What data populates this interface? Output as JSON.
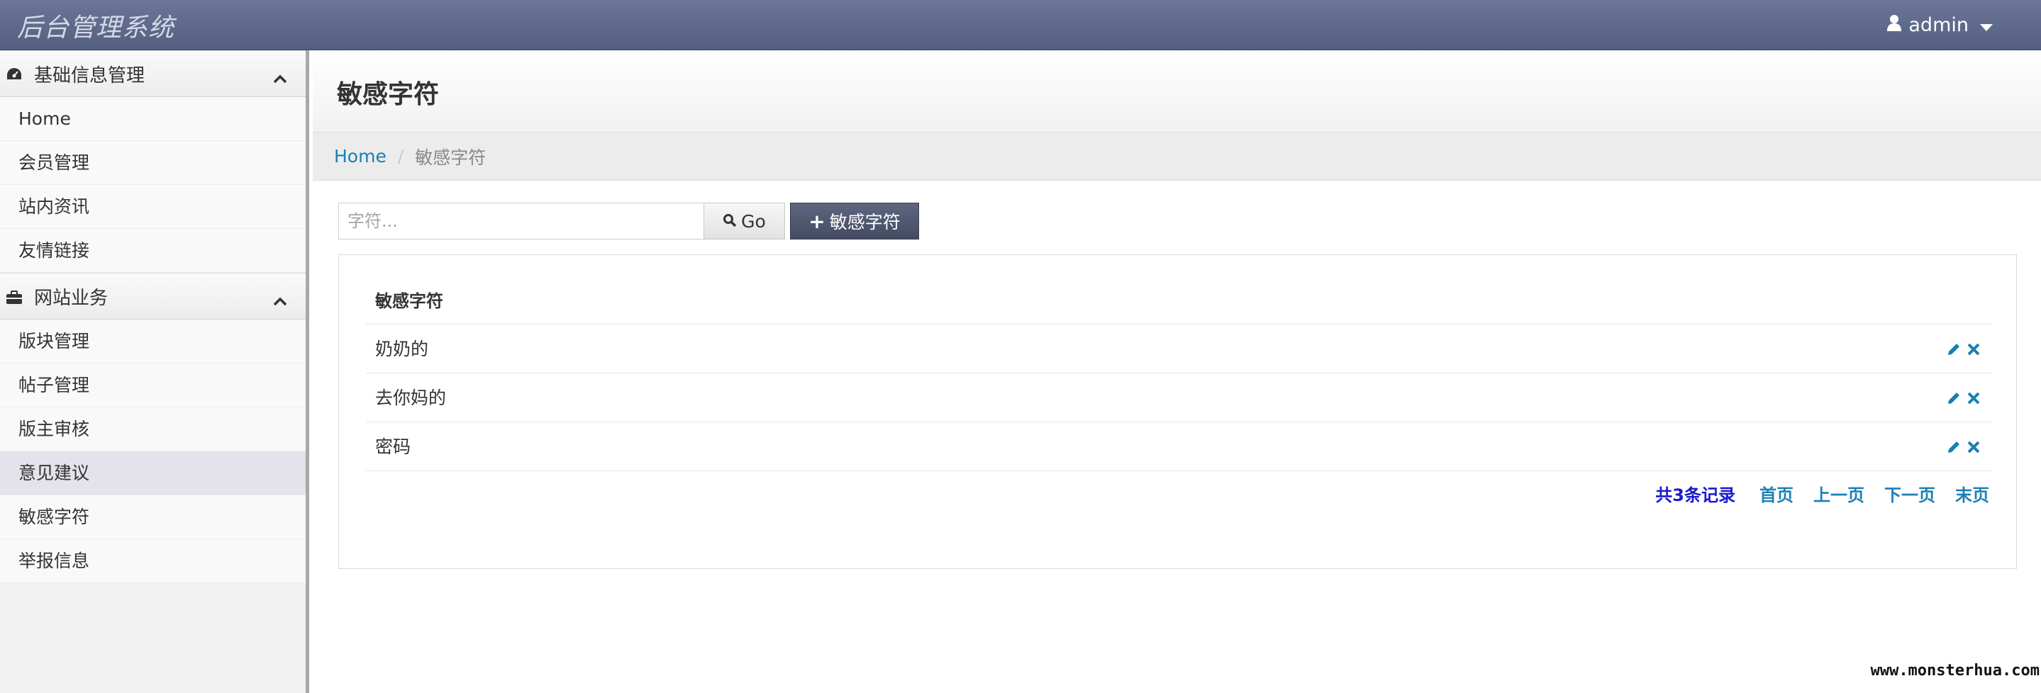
{
  "app": {
    "title": "后台管理系统"
  },
  "user": {
    "name": "admin"
  },
  "sidebar": {
    "groups": [
      {
        "title": "基础信息管理",
        "icon": "dashboard-icon",
        "items": [
          "Home",
          "会员管理",
          "站内资讯",
          "友情链接"
        ]
      },
      {
        "title": "网站业务",
        "icon": "briefcase-icon",
        "items": [
          "版块管理",
          "帖子管理",
          "版主审核",
          "意见建议",
          "敏感字符",
          "举报信息"
        ]
      }
    ],
    "active_item": "意见建议"
  },
  "page": {
    "title": "敏感字符"
  },
  "breadcrumb": {
    "home": "Home",
    "current": "敏感字符"
  },
  "toolbar": {
    "search_placeholder": "字符...",
    "go_label": "Go",
    "add_label": "敏感字符"
  },
  "table": {
    "header": "敏感字符",
    "rows": [
      "奶奶的",
      "去你妈的",
      "密码"
    ]
  },
  "pagination": {
    "total": "共3条记录",
    "first": "首页",
    "prev": "上一页",
    "next": "下一页",
    "last": "末页"
  },
  "watermark": "www.monsterhua.com",
  "colors": {
    "navbar": "#5d6789",
    "accent": "#1a7fb5",
    "primary_button": "#4f566f"
  }
}
